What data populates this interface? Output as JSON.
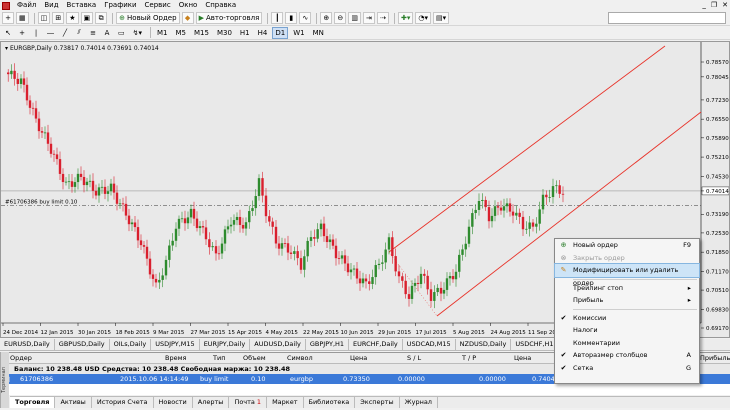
{
  "menu": [
    "Файл",
    "Вид",
    "Вставка",
    "Графики",
    "Сервис",
    "Окно",
    "Справка"
  ],
  "toolbar1": {
    "new_order_label": "Новый Ордер",
    "auto_trading_label": "Авто-торговля"
  },
  "toolbar2": {
    "timeframes": [
      "M1",
      "M5",
      "M15",
      "M30",
      "H1",
      "H4",
      "D1",
      "W1",
      "MN"
    ],
    "active_timeframe": "D1"
  },
  "chart": {
    "title": "EURGBP,Daily  0.73817 0.74014 0.73691 0.74014",
    "price_tags": [
      "0.78570",
      "0.78045",
      "0.77230",
      "0.76550",
      "0.75890",
      "0.75210",
      "0.74530",
      "0.74014",
      "0.73190",
      "0.72530",
      "0.71850",
      "0.71170",
      "0.70510",
      "0.69830",
      "0.69170"
    ],
    "current_price": "0.74014",
    "pending_order_label": "#61706386 buy limit 0.10",
    "date_labels": [
      "24 Dec 2014",
      "12 Jan 2015",
      "30 Jan 2015",
      "18 Feb 2015",
      "9 Mar 2015",
      "27 Mar 2015",
      "15 Apr 2015",
      "4 May 2015",
      "22 May 2015",
      "10 Jun 2015",
      "29 Jun 2015",
      "17 Jul 2015",
      "5 Aug 2015",
      "24 Aug 2015",
      "11 Sep 2015"
    ],
    "colors": {
      "bull": "#2e8b2e",
      "bear": "#d9202e",
      "channel": "#e8332a",
      "grid": "#dcdcdc"
    }
  },
  "chart_tabs": [
    "EURUSD,Daily",
    "GBPUSD,Daily",
    "OILs,Daily",
    "USDJPY,M15",
    "EURJPY,Daily",
    "AUDUSD,Daily",
    "GBPJPY,H1",
    "EURCHF,Daily",
    "USDCAD,M15",
    "NZDUSD,Daily",
    "USDCHF,H1",
    "EURGBP,Daily"
  ],
  "terminal": {
    "columns": [
      "Ордер",
      "Время",
      "Тип",
      "Объем",
      "Символ",
      "Цена",
      "S / L",
      "T / P",
      "Цена",
      "Прибыль"
    ],
    "balance_text": "Баланс: 10 238.48 USD  Средства: 10 238.48  Свободная маржа: 10 238.48",
    "order": {
      "id": "61706386",
      "time": "2015.10.06 14:14:49",
      "type": "buy limit",
      "volume": "0.10",
      "symbol": "eurgbp",
      "price": "0.73350",
      "sl": "0.00000",
      "tp": "0.00000",
      "current": "0.74042"
    },
    "side_label": "Терминал"
  },
  "bottom_tabs": [
    "Торговля",
    "Активы",
    "История Счета",
    "Новости",
    "Алерты",
    "Почта",
    "Маркет",
    "Библиотека",
    "Эксперты",
    "Журнал"
  ],
  "mail_badge": "1",
  "context_menu": [
    {
      "label": "Новый ордер",
      "shortcut": "F9",
      "icon": "new-order-icon",
      "state": "normal"
    },
    {
      "label": "Закрыть ордер",
      "shortcut": "",
      "icon": "close-order-icon",
      "state": "disabled"
    },
    {
      "label": "Модифицировать или удалить ордер",
      "shortcut": "",
      "icon": "modify-order-icon",
      "state": "highlighted"
    },
    {
      "sep": true
    },
    {
      "label": "Трейлинг стоп",
      "shortcut": "▸",
      "icon": "",
      "state": "normal"
    },
    {
      "label": "Прибыль",
      "shortcut": "▸",
      "icon": "",
      "state": "normal"
    },
    {
      "sep": true
    },
    {
      "label": "Комиссии",
      "shortcut": "",
      "icon": "check-icon",
      "state": "normal"
    },
    {
      "label": "Налоги",
      "shortcut": "",
      "icon": "",
      "state": "normal"
    },
    {
      "label": "Комментарии",
      "shortcut": "",
      "icon": "",
      "state": "normal"
    },
    {
      "label": "Авторазмер столбцов",
      "shortcut": "A",
      "icon": "check-icon",
      "state": "normal"
    },
    {
      "label": "Сетка",
      "shortcut": "G",
      "icon": "check-icon",
      "state": "normal"
    }
  ]
}
